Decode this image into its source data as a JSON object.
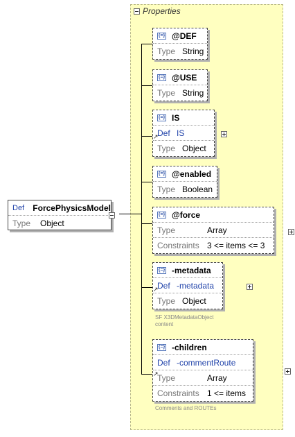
{
  "group": {
    "title": "Properties"
  },
  "root": {
    "def_label": "Def",
    "name": "ForcePhysicsModel",
    "type_label": "Type",
    "type_value": "Object"
  },
  "attr_icon": "{=}",
  "nodes": [
    {
      "name": "@DEF",
      "rows": [
        {
          "label": "Type",
          "value": "String"
        }
      ]
    },
    {
      "name": "@USE",
      "rows": [
        {
          "label": "Type",
          "value": "String"
        }
      ]
    },
    {
      "name": "IS",
      "rows": [
        {
          "label": "Def",
          "value": "IS"
        },
        {
          "label": "Type",
          "value": "Object"
        }
      ]
    },
    {
      "name": "@enabled",
      "rows": [
        {
          "label": "Type",
          "value": "Boolean"
        }
      ]
    },
    {
      "name": "@force",
      "rows": [
        {
          "label": "Type",
          "value": "Array"
        },
        {
          "label": "Constraints",
          "value": "3 <= items <= 3"
        }
      ]
    },
    {
      "name": "-metadata",
      "rows": [
        {
          "label": "Def",
          "value": "-metadata"
        },
        {
          "label": "Type",
          "value": "Object"
        }
      ],
      "note": [
        "SF X3DMetadataObject",
        "content"
      ]
    },
    {
      "name": "-children",
      "rows": [
        {
          "label": "Def",
          "value": "-commentRoute"
        },
        {
          "label": "Type",
          "value": "Array"
        },
        {
          "label": "Constraints",
          "value": "1 <= items"
        }
      ],
      "note": [
        "Comments and ROUTEs"
      ]
    }
  ]
}
